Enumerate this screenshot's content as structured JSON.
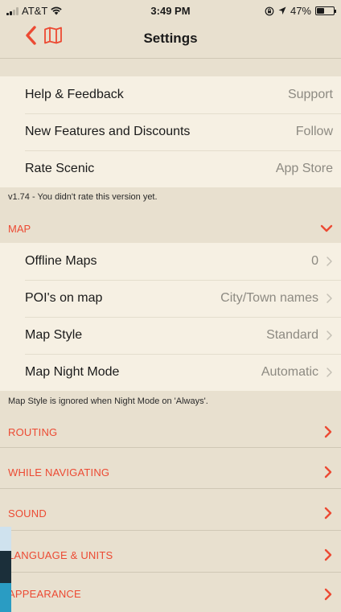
{
  "status_bar": {
    "carrier": "AT&T",
    "time": "3:49 PM",
    "battery": "47%",
    "battery_level": 0.47,
    "icons": [
      "signal-icon",
      "wifi-icon",
      "orientation-lock-icon",
      "location-arrow-icon",
      "battery-icon"
    ]
  },
  "nav": {
    "title": "Settings",
    "back_icon": "chevron-left-icon",
    "map_icon": "map-icon"
  },
  "colors": {
    "accent": "#ec4a33",
    "background": "#e8e0cf",
    "row_background": "#f6f0e3",
    "secondary_text": "#8d8a82"
  },
  "general": {
    "rows": [
      {
        "label": "Help & Feedback",
        "value": "Support"
      },
      {
        "label": "New Features and Discounts",
        "value": "Follow"
      },
      {
        "label": "Rate Scenic",
        "value": "App Store"
      }
    ],
    "footnote": "v1.74 - You didn't rate this version yet."
  },
  "map_section": {
    "header": "MAP",
    "expanded": true,
    "rows": [
      {
        "label": "Offline Maps",
        "value": "0"
      },
      {
        "label": "POI's on map",
        "value": "City/Town names"
      },
      {
        "label": "Map Style",
        "value": "Standard"
      },
      {
        "label": "Map Night Mode",
        "value": "Automatic"
      }
    ],
    "footnote": "Map Style is ignored when Night Mode on 'Always'."
  },
  "collapsed_sections": [
    {
      "label": "ROUTING"
    },
    {
      "label": "WHILE NAVIGATING"
    },
    {
      "label": "SOUND"
    },
    {
      "label": "LANGUAGE & UNITS"
    },
    {
      "label": "APPEARANCE"
    }
  ]
}
